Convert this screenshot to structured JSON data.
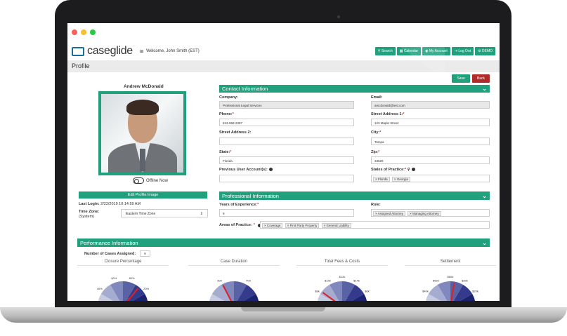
{
  "window": {
    "dot_colors": [
      "#ff5f56",
      "#ffbd2e",
      "#27c93f"
    ]
  },
  "app": {
    "logo_text": "caseglide",
    "welcome": "Welcome, John Smith (EST)",
    "nav": {
      "search": "Search",
      "calendar": "Calendar",
      "my_account": "My Account",
      "logout": "Log Out",
      "demo": "DEMO"
    },
    "accent_color": "#21a07e"
  },
  "page": {
    "title": "Profile",
    "save_label": "Save",
    "back_label": "Back"
  },
  "profile": {
    "name": "Andrew McDonald",
    "status": "Offline Now",
    "edit_image_label": "Edit Profile Image",
    "last_login_label": "Last Login:",
    "last_login_value": "2/22/2019 10:14:59 AM",
    "timezone_label": "Time Zone:",
    "timezone_sub": "(System)",
    "timezone_value": "Eastern Time Zone"
  },
  "contact": {
    "title": "Contact Information",
    "company_label": "Company:",
    "company_value": "Professional Legal Services",
    "email_label": "Email:",
    "email_value": "amcdonald@test.com",
    "phone_label": "Phone:",
    "phone_value": "813-658-2357",
    "street1_label": "Street Address 1:",
    "street1_value": "123 Maple Street",
    "street2_label": "Street Address 2:",
    "street2_value": "",
    "city_label": "City:",
    "city_value": "Tampa",
    "state_label": "State:",
    "state_value": "Florida",
    "zip_label": "Zip:",
    "zip_value": "33629",
    "prev_accounts_label": "Previous User Account(s):",
    "states_practice_label": "States of Practice:",
    "states_practice": [
      "Florida",
      "Georgia"
    ]
  },
  "professional": {
    "title": "Professional Information",
    "years_label": "Years of Experience:",
    "years_value": "9",
    "role_label": "Role:",
    "roles": [
      "Assigned Attorney",
      "Managing Attorney"
    ],
    "areas_label": "Areas of Practice:",
    "areas": [
      "Coverage",
      "First Party Property",
      "General Liability"
    ]
  },
  "performance": {
    "title": "Performance Information",
    "cases_label": "Number of Cases Assigned:",
    "cases_value": "9",
    "gauges": [
      {
        "title": "Closure Percentage",
        "ticks": [
          "40%",
          "60%",
          "80%",
          "20%"
        ],
        "level": 0.72
      },
      {
        "title": "Case Duration",
        "ticks": [
          "300",
          "400"
        ],
        "level": 0.35
      },
      {
        "title": "Total Fees & Costs",
        "ticks": [
          "$8k",
          "$10k",
          "$12k",
          "$14k",
          "$6k"
        ],
        "level": 0.2
      },
      {
        "title": "Settlement",
        "ticks": [
          "$40k",
          "$50k",
          "$60k",
          "$30k",
          "$20k"
        ],
        "level": 0.55
      }
    ]
  }
}
